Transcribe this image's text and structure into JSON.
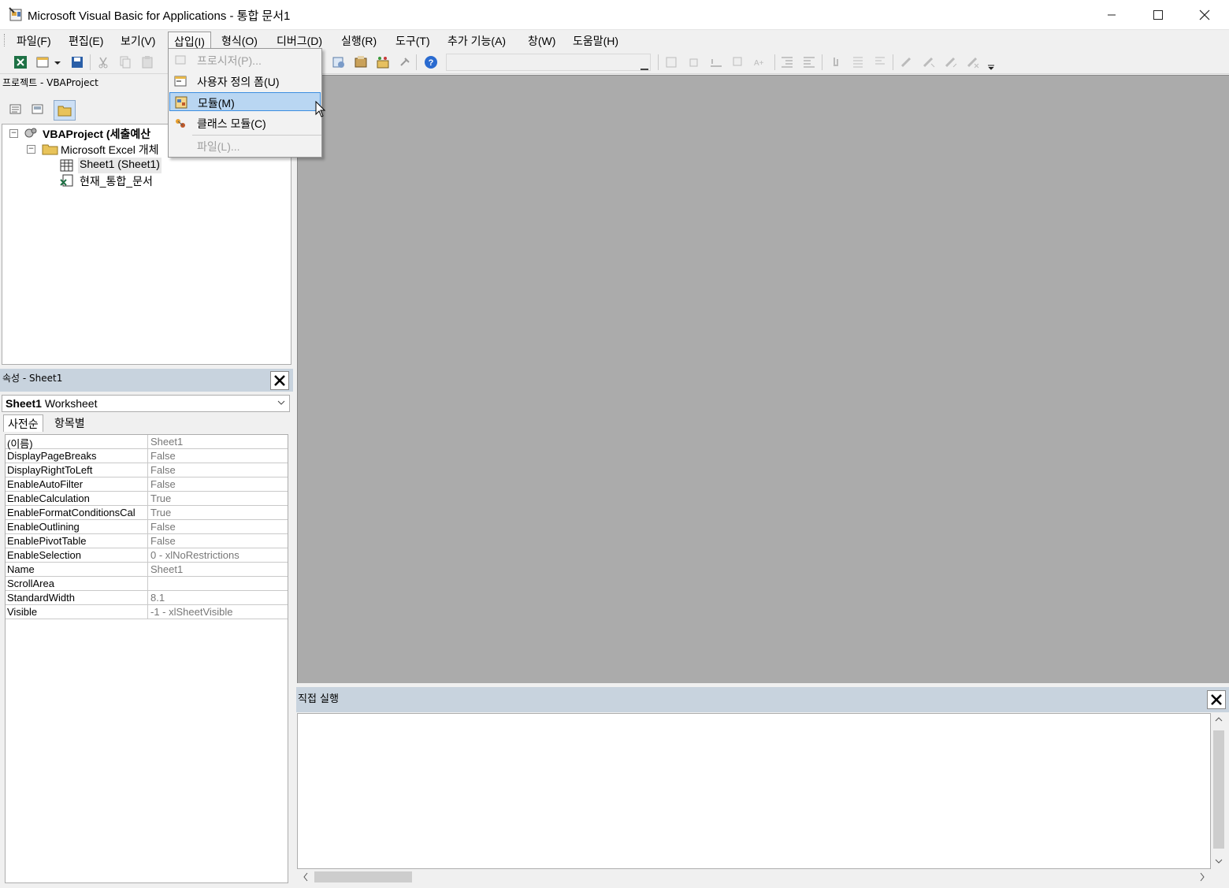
{
  "window": {
    "title": "Microsoft Visual Basic for Applications - 통합 문서1",
    "minimize_icon": "minimize-icon",
    "maximize_icon": "maximize-icon",
    "close_icon": "close-icon"
  },
  "menubar": {
    "items": [
      {
        "label": "파일(F)"
      },
      {
        "label": "편집(E)"
      },
      {
        "label": "보기(V)"
      },
      {
        "label": "삽입(I)"
      },
      {
        "label": "형식(O)"
      },
      {
        "label": "디버그(D)"
      },
      {
        "label": "실행(R)"
      },
      {
        "label": "도구(T)"
      },
      {
        "label": "추가 기능(A)"
      },
      {
        "label": "창(W)"
      },
      {
        "label": "도움말(H)"
      }
    ],
    "active": "삽입(I)"
  },
  "insert_menu": {
    "items": [
      {
        "label": "프로시저(P)...",
        "disabled": true
      },
      {
        "label": "사용자 정의 폼(U)",
        "disabled": false
      },
      {
        "label": "모듈(M)",
        "disabled": false,
        "highlighted": true
      },
      {
        "label": "클래스 모듈(C)",
        "disabled": false
      },
      {
        "label": "파일(L)...",
        "disabled": true
      }
    ]
  },
  "project": {
    "title": "프로젝트 - VBAProject",
    "tree": {
      "root": "VBAProject (세출예산",
      "folder": "Microsoft Excel 개체",
      "sheet": "Sheet1 (Sheet1)",
      "workbook": "현재_통합_문서"
    }
  },
  "properties": {
    "title": "속성 - Sheet1",
    "object_name": "Sheet1",
    "object_type": "Worksheet",
    "tabs": [
      "사전순",
      "항목별"
    ],
    "rows": [
      {
        "name": "(이름)",
        "value": "Sheet1"
      },
      {
        "name": "DisplayPageBreaks",
        "value": "False"
      },
      {
        "name": "DisplayRightToLeft",
        "value": "False"
      },
      {
        "name": "EnableAutoFilter",
        "value": "False"
      },
      {
        "name": "EnableCalculation",
        "value": "True"
      },
      {
        "name": "EnableFormatConditionsCal",
        "value": "True"
      },
      {
        "name": "EnableOutlining",
        "value": "False"
      },
      {
        "name": "EnablePivotTable",
        "value": "False"
      },
      {
        "name": "EnableSelection",
        "value": "0 - xlNoRestrictions"
      },
      {
        "name": "Name",
        "value": "Sheet1"
      },
      {
        "name": "ScrollArea",
        "value": ""
      },
      {
        "name": "StandardWidth",
        "value": "8.1"
      },
      {
        "name": "Visible",
        "value": "-1 - xlSheetVisible"
      }
    ]
  },
  "immediate": {
    "title": "직접 실행"
  },
  "colors": {
    "pane_header": "#c8d3de",
    "mdi_background": "#ababab",
    "menu_highlight": "#b9d6f2"
  }
}
